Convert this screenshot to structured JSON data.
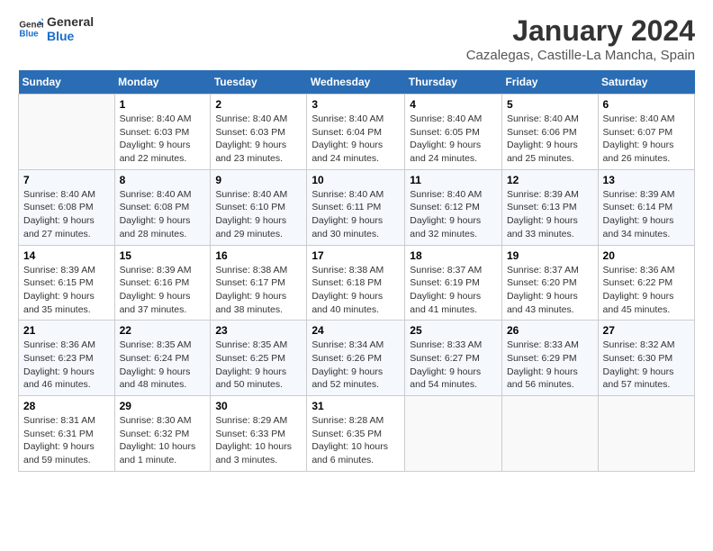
{
  "header": {
    "logo_general": "General",
    "logo_blue": "Blue",
    "title": "January 2024",
    "location": "Cazalegas, Castille-La Mancha, Spain"
  },
  "weekdays": [
    "Sunday",
    "Monday",
    "Tuesday",
    "Wednesday",
    "Thursday",
    "Friday",
    "Saturday"
  ],
  "weeks": [
    [
      {
        "day": "",
        "info": ""
      },
      {
        "day": "1",
        "info": "Sunrise: 8:40 AM\nSunset: 6:03 PM\nDaylight: 9 hours\nand 22 minutes."
      },
      {
        "day": "2",
        "info": "Sunrise: 8:40 AM\nSunset: 6:03 PM\nDaylight: 9 hours\nand 23 minutes."
      },
      {
        "day": "3",
        "info": "Sunrise: 8:40 AM\nSunset: 6:04 PM\nDaylight: 9 hours\nand 24 minutes."
      },
      {
        "day": "4",
        "info": "Sunrise: 8:40 AM\nSunset: 6:05 PM\nDaylight: 9 hours\nand 24 minutes."
      },
      {
        "day": "5",
        "info": "Sunrise: 8:40 AM\nSunset: 6:06 PM\nDaylight: 9 hours\nand 25 minutes."
      },
      {
        "day": "6",
        "info": "Sunrise: 8:40 AM\nSunset: 6:07 PM\nDaylight: 9 hours\nand 26 minutes."
      }
    ],
    [
      {
        "day": "7",
        "info": ""
      },
      {
        "day": "8",
        "info": "Sunrise: 8:40 AM\nSunset: 6:08 PM\nDaylight: 9 hours\nand 28 minutes."
      },
      {
        "day": "9",
        "info": "Sunrise: 8:40 AM\nSunset: 6:10 PM\nDaylight: 9 hours\nand 29 minutes."
      },
      {
        "day": "10",
        "info": "Sunrise: 8:40 AM\nSunset: 6:11 PM\nDaylight: 9 hours\nand 30 minutes."
      },
      {
        "day": "11",
        "info": "Sunrise: 8:40 AM\nSunset: 6:12 PM\nDaylight: 9 hours\nand 32 minutes."
      },
      {
        "day": "12",
        "info": "Sunrise: 8:39 AM\nSunset: 6:13 PM\nDaylight: 9 hours\nand 33 minutes."
      },
      {
        "day": "13",
        "info": "Sunrise: 8:39 AM\nSunset: 6:14 PM\nDaylight: 9 hours\nand 34 minutes."
      }
    ],
    [
      {
        "day": "14",
        "info": ""
      },
      {
        "day": "15",
        "info": "Sunrise: 8:39 AM\nSunset: 6:16 PM\nDaylight: 9 hours\nand 37 minutes."
      },
      {
        "day": "16",
        "info": "Sunrise: 8:38 AM\nSunset: 6:17 PM\nDaylight: 9 hours\nand 38 minutes."
      },
      {
        "day": "17",
        "info": "Sunrise: 8:38 AM\nSunset: 6:18 PM\nDaylight: 9 hours\nand 40 minutes."
      },
      {
        "day": "18",
        "info": "Sunrise: 8:37 AM\nSunset: 6:19 PM\nDaylight: 9 hours\nand 41 minutes."
      },
      {
        "day": "19",
        "info": "Sunrise: 8:37 AM\nSunset: 6:20 PM\nDaylight: 9 hours\nand 43 minutes."
      },
      {
        "day": "20",
        "info": "Sunrise: 8:36 AM\nSunset: 6:22 PM\nDaylight: 9 hours\nand 45 minutes."
      }
    ],
    [
      {
        "day": "21",
        "info": ""
      },
      {
        "day": "22",
        "info": "Sunrise: 8:35 AM\nSunset: 6:24 PM\nDaylight: 9 hours\nand 48 minutes."
      },
      {
        "day": "23",
        "info": "Sunrise: 8:35 AM\nSunset: 6:25 PM\nDaylight: 9 hours\nand 50 minutes."
      },
      {
        "day": "24",
        "info": "Sunrise: 8:34 AM\nSunset: 6:26 PM\nDaylight: 9 hours\nand 52 minutes."
      },
      {
        "day": "25",
        "info": "Sunrise: 8:33 AM\nSunset: 6:27 PM\nDaylight: 9 hours\nand 54 minutes."
      },
      {
        "day": "26",
        "info": "Sunrise: 8:33 AM\nSunset: 6:29 PM\nDaylight: 9 hours\nand 56 minutes."
      },
      {
        "day": "27",
        "info": "Sunrise: 8:32 AM\nSunset: 6:30 PM\nDaylight: 9 hours\nand 57 minutes."
      }
    ],
    [
      {
        "day": "28",
        "info": "Sunrise: 8:31 AM\nSunset: 6:31 PM\nDaylight: 9 hours\nand 59 minutes."
      },
      {
        "day": "29",
        "info": "Sunrise: 8:30 AM\nSunset: 6:32 PM\nDaylight: 10 hours\nand 1 minute."
      },
      {
        "day": "30",
        "info": "Sunrise: 8:29 AM\nSunset: 6:33 PM\nDaylight: 10 hours\nand 3 minutes."
      },
      {
        "day": "31",
        "info": "Sunrise: 8:28 AM\nSunset: 6:35 PM\nDaylight: 10 hours\nand 6 minutes."
      },
      {
        "day": "",
        "info": ""
      },
      {
        "day": "",
        "info": ""
      },
      {
        "day": "",
        "info": ""
      }
    ]
  ],
  "week1_day7_info": "Sunrise: 8:40 AM\nSunset: 6:08 PM\nDaylight: 9 hours\nand 27 minutes.",
  "week2_day1_info": "Sunrise: 8:40 AM\nSunset: 6:08 PM\nDaylight: 9 hours\nand 27 minutes.",
  "week3_day1_info": "Sunrise: 8:39 AM\nSunset: 6:15 PM\nDaylight: 9 hours\nand 35 minutes.",
  "week4_day1_info": "Sunrise: 8:36 AM\nSunset: 6:23 PM\nDaylight: 9 hours\nand 46 minutes."
}
